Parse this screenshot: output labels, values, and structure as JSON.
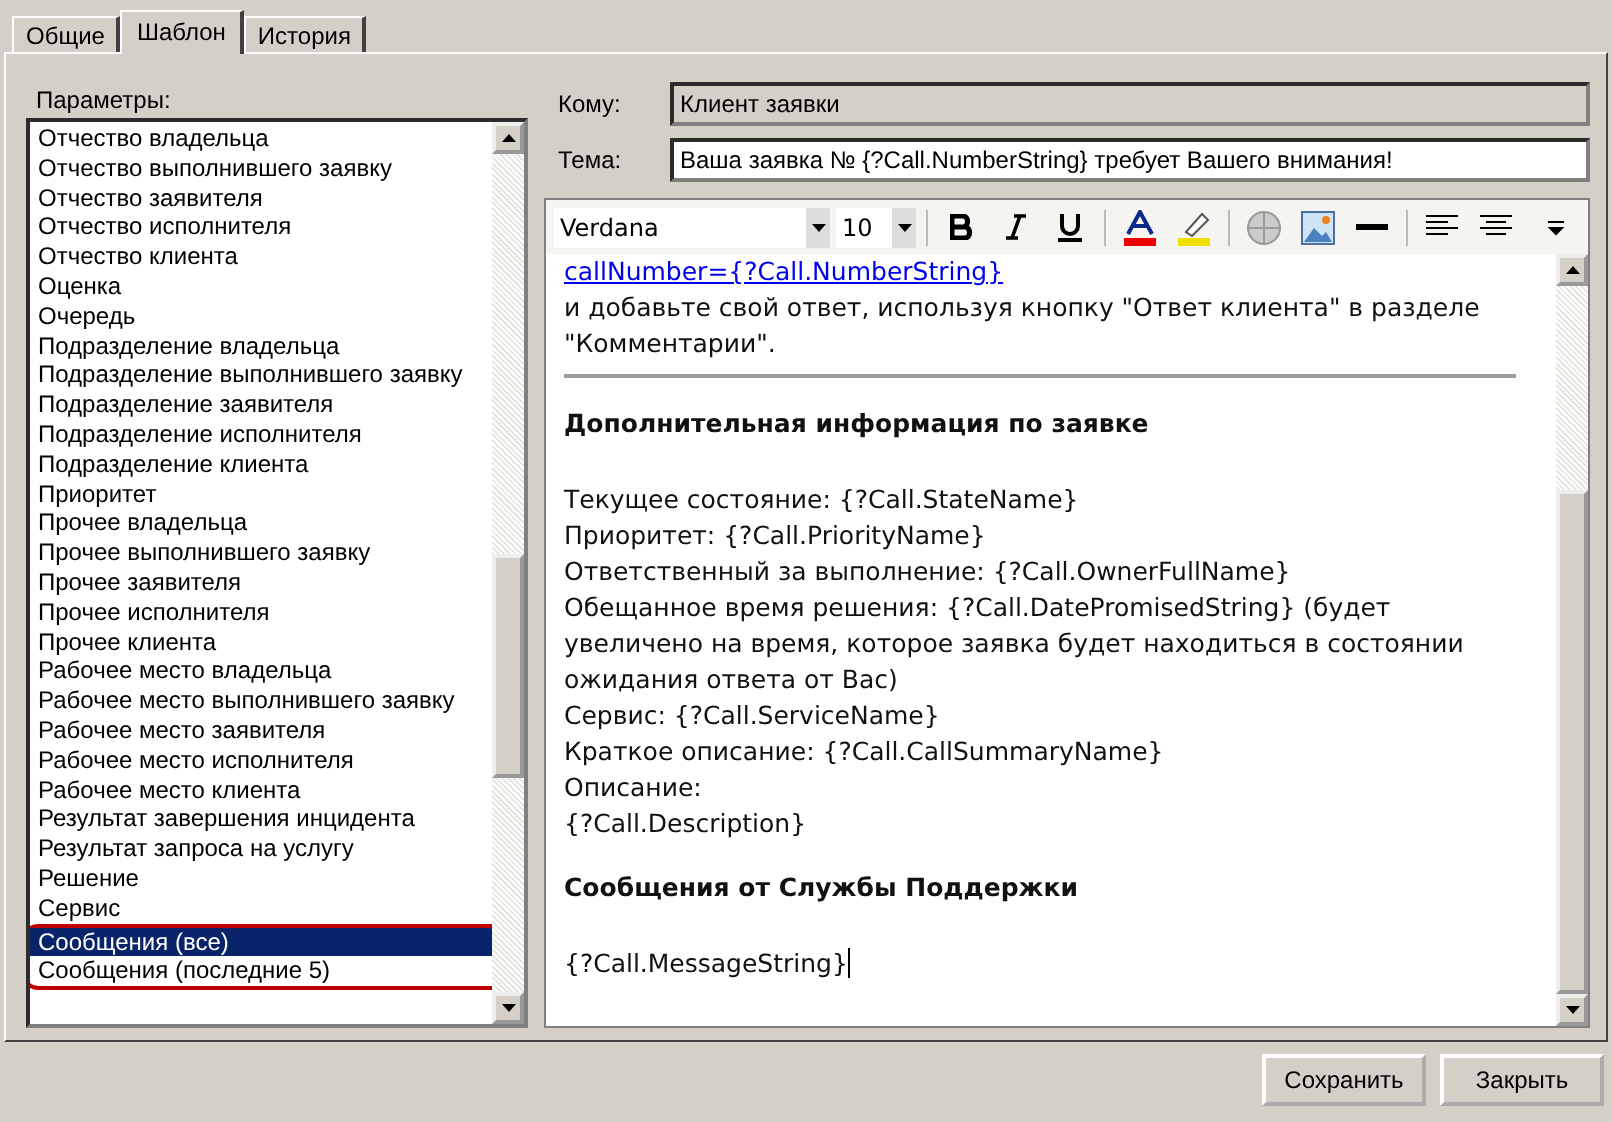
{
  "tabs": [
    {
      "label": "Общие",
      "selected": false
    },
    {
      "label": "Шаблон",
      "selected": true
    },
    {
      "label": "История",
      "selected": false
    }
  ],
  "parameters": {
    "label": "Параметры:",
    "items": [
      {
        "text": "Отчество владельца",
        "selected": false,
        "circled": false
      },
      {
        "text": "Отчество выполнившего заявку",
        "selected": false,
        "circled": false
      },
      {
        "text": "Отчество заявителя",
        "selected": false,
        "circled": false
      },
      {
        "text": "Отчество исполнителя",
        "selected": false,
        "circled": false
      },
      {
        "text": "Отчество клиента",
        "selected": false,
        "circled": false
      },
      {
        "text": "Оценка",
        "selected": false,
        "circled": false
      },
      {
        "text": "Очередь",
        "selected": false,
        "circled": false
      },
      {
        "text": "Подразделение владельца",
        "selected": false,
        "circled": false
      },
      {
        "text": "Подразделение выполнившего заявку",
        "selected": false,
        "circled": false
      },
      {
        "text": "Подразделение заявителя",
        "selected": false,
        "circled": false
      },
      {
        "text": "Подразделение исполнителя",
        "selected": false,
        "circled": false
      },
      {
        "text": "Подразделение клиента",
        "selected": false,
        "circled": false
      },
      {
        "text": "Приоритет",
        "selected": false,
        "circled": false
      },
      {
        "text": "Прочее владельца",
        "selected": false,
        "circled": false
      },
      {
        "text": "Прочее выполнившего заявку",
        "selected": false,
        "circled": false
      },
      {
        "text": "Прочее заявителя",
        "selected": false,
        "circled": false
      },
      {
        "text": "Прочее исполнителя",
        "selected": false,
        "circled": false
      },
      {
        "text": "Прочее клиента",
        "selected": false,
        "circled": false
      },
      {
        "text": "Рабочее место владельца",
        "selected": false,
        "circled": false
      },
      {
        "text": "Рабочее место выполнившего заявку",
        "selected": false,
        "circled": false
      },
      {
        "text": "Рабочее место заявителя",
        "selected": false,
        "circled": false
      },
      {
        "text": "Рабочее место исполнителя",
        "selected": false,
        "circled": false
      },
      {
        "text": "Рабочее место клиента",
        "selected": false,
        "circled": false
      },
      {
        "text": "Результат завершения инцидента",
        "selected": false,
        "circled": false
      },
      {
        "text": "Результат запроса на услугу",
        "selected": false,
        "circled": false
      },
      {
        "text": "Решение",
        "selected": false,
        "circled": false
      },
      {
        "text": "Сервис",
        "selected": false,
        "circled": false
      },
      {
        "text": "Сообщения (все)",
        "selected": true,
        "circled": true
      },
      {
        "text": "Сообщения (последние 5)",
        "selected": false,
        "circled": true
      }
    ]
  },
  "to": {
    "label": "Кому:",
    "value": "Клиент заявки",
    "disabled": true
  },
  "subject": {
    "label": "Тема:",
    "value": "Ваша заявка № {?Call.NumberString} требует Вашего внимания!",
    "disabled": false
  },
  "toolbar": {
    "font": "Verdana",
    "size": "10"
  },
  "editor": {
    "blocks": [
      {
        "kind": "link",
        "text": "callNumber={?Call.NumberString}"
      },
      {
        "kind": "paragraph",
        "text": "и добавьте свой ответ, используя кнопку \"Ответ клиента\" в разделе \"Комментарии\"."
      },
      {
        "kind": "rule"
      },
      {
        "kind": "heading",
        "text": "Дополнительная информация по заявке"
      },
      {
        "kind": "paragraph",
        "text": "Текущее состояние: {?Call.StateName}"
      },
      {
        "kind": "paragraph",
        "text": "Приоритет: {?Call.PriorityName}"
      },
      {
        "kind": "paragraph",
        "text": "Ответственный за выполнение: {?Call.OwnerFullName}"
      },
      {
        "kind": "paragraph",
        "text": "Обещанное время решения: {?Call.DatePromisedString} (будет увеличено на время, которое заявка будет находиться в состоянии ожидания ответа от Вас)"
      },
      {
        "kind": "paragraph",
        "text": "Сервис: {?Call.ServiceName}"
      },
      {
        "kind": "paragraph",
        "text": "Краткое описание: {?Call.CallSummaryName}"
      },
      {
        "kind": "paragraph",
        "text": "Описание:"
      },
      {
        "kind": "paragraph",
        "text": "{?Call.Description}"
      },
      {
        "kind": "heading",
        "text": "Сообщения от Службы Поддержки"
      },
      {
        "kind": "caret",
        "text": "{?Call.MessageString}"
      }
    ]
  },
  "buttons": [
    "Сохранить",
    "Закрыть"
  ]
}
